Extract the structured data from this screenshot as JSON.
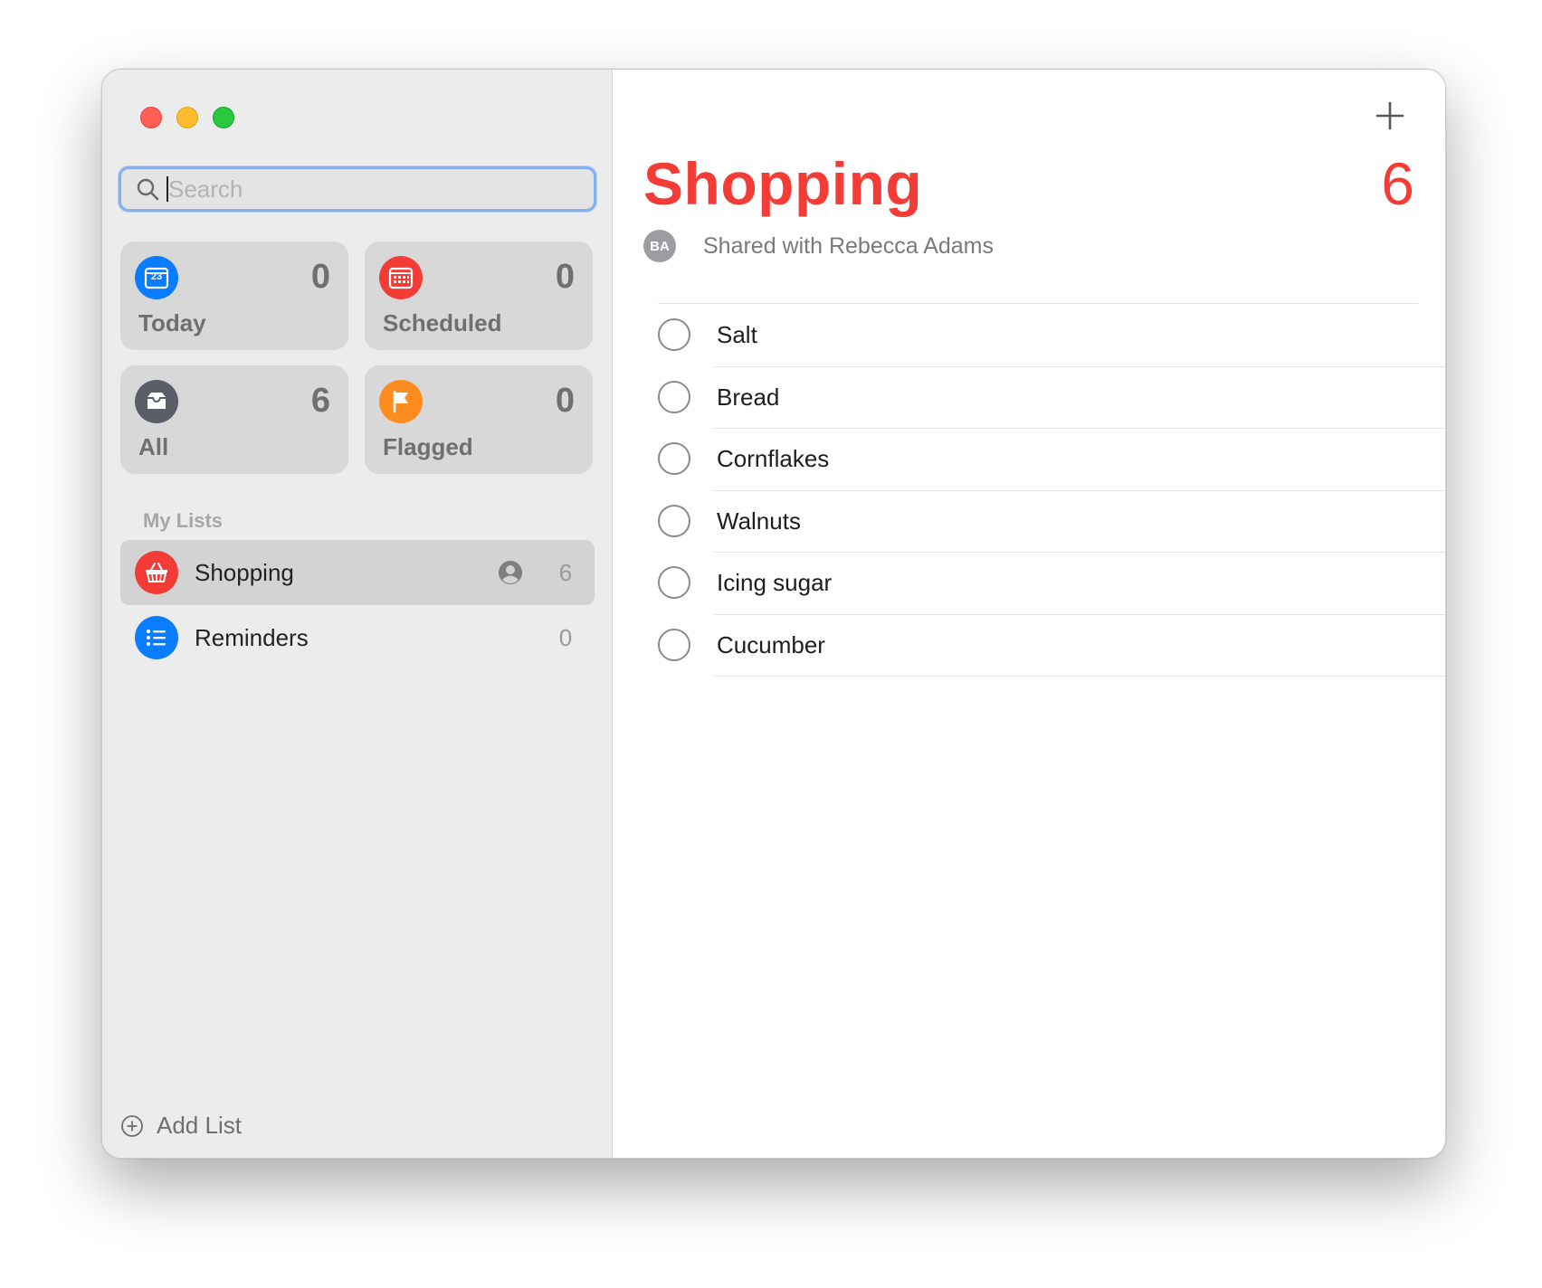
{
  "window": {
    "controls": [
      "close",
      "minimize",
      "maximize"
    ]
  },
  "search": {
    "placeholder": "Search",
    "value": ""
  },
  "smart_lists": [
    {
      "label": "Today",
      "count": "0",
      "icon": "calendar-icon",
      "color": "#0a7cff",
      "day": "23"
    },
    {
      "label": "Scheduled",
      "count": "0",
      "icon": "calendar-grid-icon",
      "color": "#f23c35"
    },
    {
      "label": "All",
      "count": "6",
      "icon": "tray-icon",
      "color": "#5a5e66"
    },
    {
      "label": "Flagged",
      "count": "0",
      "icon": "flag-icon",
      "color": "#fd8c1f"
    }
  ],
  "my_lists": {
    "header": "My Lists",
    "items": [
      {
        "name": "Shopping",
        "count": "6",
        "icon": "basket-icon",
        "color": "#f23c35",
        "shared": true,
        "selected": true
      },
      {
        "name": "Reminders",
        "count": "0",
        "icon": "list-bullet-icon",
        "color": "#0a7cff",
        "shared": false,
        "selected": false
      }
    ]
  },
  "add_list_label": "Add List",
  "main": {
    "title": "Shopping",
    "count": "6",
    "accent_color": "#f23c35",
    "shared_avatar": "BA",
    "shared_text": "Shared with Rebecca Adams",
    "items": [
      "Salt",
      "Bread",
      "Cornflakes",
      "Walnuts",
      "Icing sugar",
      "Cucumber"
    ]
  }
}
